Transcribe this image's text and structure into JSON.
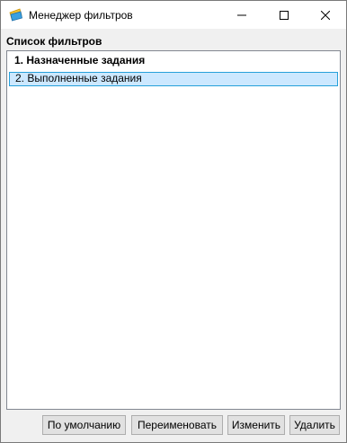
{
  "window": {
    "title": "Менеджер фильтров",
    "icon": "filter-manager-app-icon",
    "controls": [
      "minimize-icon",
      "maximize-icon",
      "close-icon"
    ]
  },
  "panel": {
    "label": "Список фильтров"
  },
  "filters": {
    "items": [
      {
        "label": "1. Назначенные задания",
        "bold": true,
        "selected": false
      },
      {
        "label": "2. Выполненные задания",
        "bold": false,
        "selected": true
      }
    ]
  },
  "buttons": {
    "default": "По умолчанию",
    "rename": "Переименовать",
    "edit": "Изменить",
    "delete": "Удалить"
  },
  "colors": {
    "selection_bg": "#cce8ff",
    "selection_border": "#26a0da"
  }
}
